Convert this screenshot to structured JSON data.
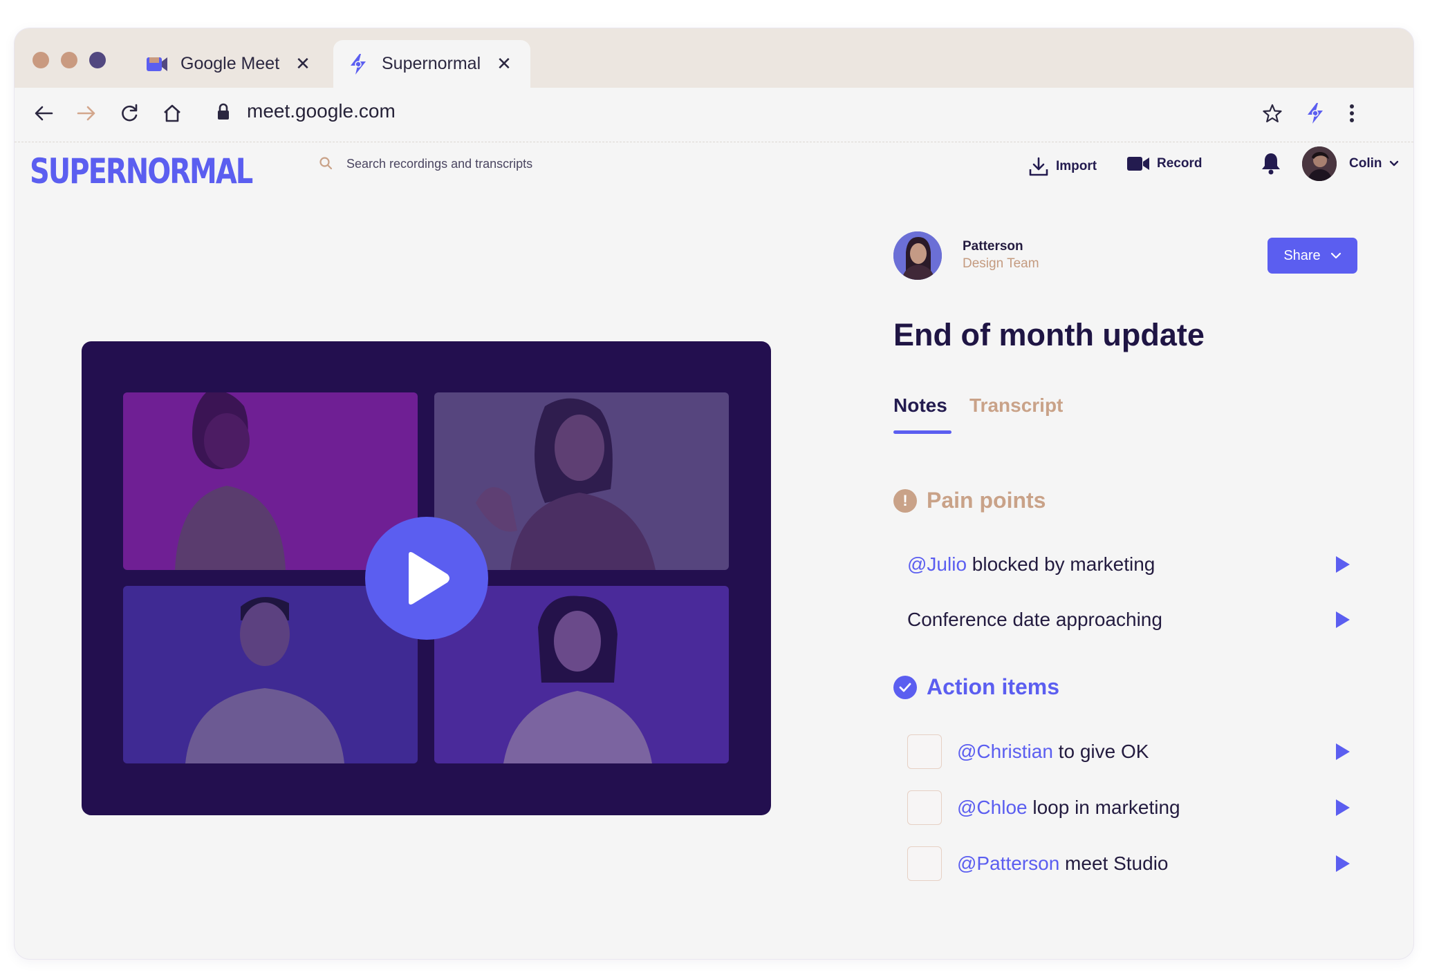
{
  "browser": {
    "tabs": [
      {
        "label": "Google Meet",
        "icon": "google-meet-icon",
        "active": false
      },
      {
        "label": "Supernormal",
        "icon": "supernormal-icon",
        "active": true
      }
    ],
    "url": "meet.google.com",
    "dot_colors": [
      "#c99a80",
      "#c99a80",
      "#524880"
    ]
  },
  "app": {
    "logo": "SUPERNORMAL",
    "search_placeholder": "Search recordings and transcripts",
    "import_label": "Import",
    "record_label": "Record",
    "user_name": "Colin"
  },
  "meeting": {
    "owner_name": "Patterson",
    "owner_team": "Design Team",
    "share_label": "Share",
    "title": "End of month update",
    "tabs": {
      "notes": "Notes",
      "transcript": "Transcript"
    },
    "pain_points": {
      "heading": "Pain points",
      "items": [
        {
          "mention": "@Julio",
          "text": " blocked by marketing"
        },
        {
          "mention": "",
          "text": "Conference date approaching"
        }
      ]
    },
    "action_items": {
      "heading": "Action items",
      "items": [
        {
          "mention": "@Christian",
          "text": " to give OK",
          "checked": false
        },
        {
          "mention": "@Chloe",
          "text": " loop in marketing",
          "checked": false
        },
        {
          "mention": "@Patterson",
          "text": " meet Studio",
          "checked": false
        }
      ]
    }
  },
  "colors": {
    "accent": "#5b5ef0",
    "dark": "#1f1544",
    "warm": "#c9a288",
    "player_bg": "#230f4f"
  }
}
